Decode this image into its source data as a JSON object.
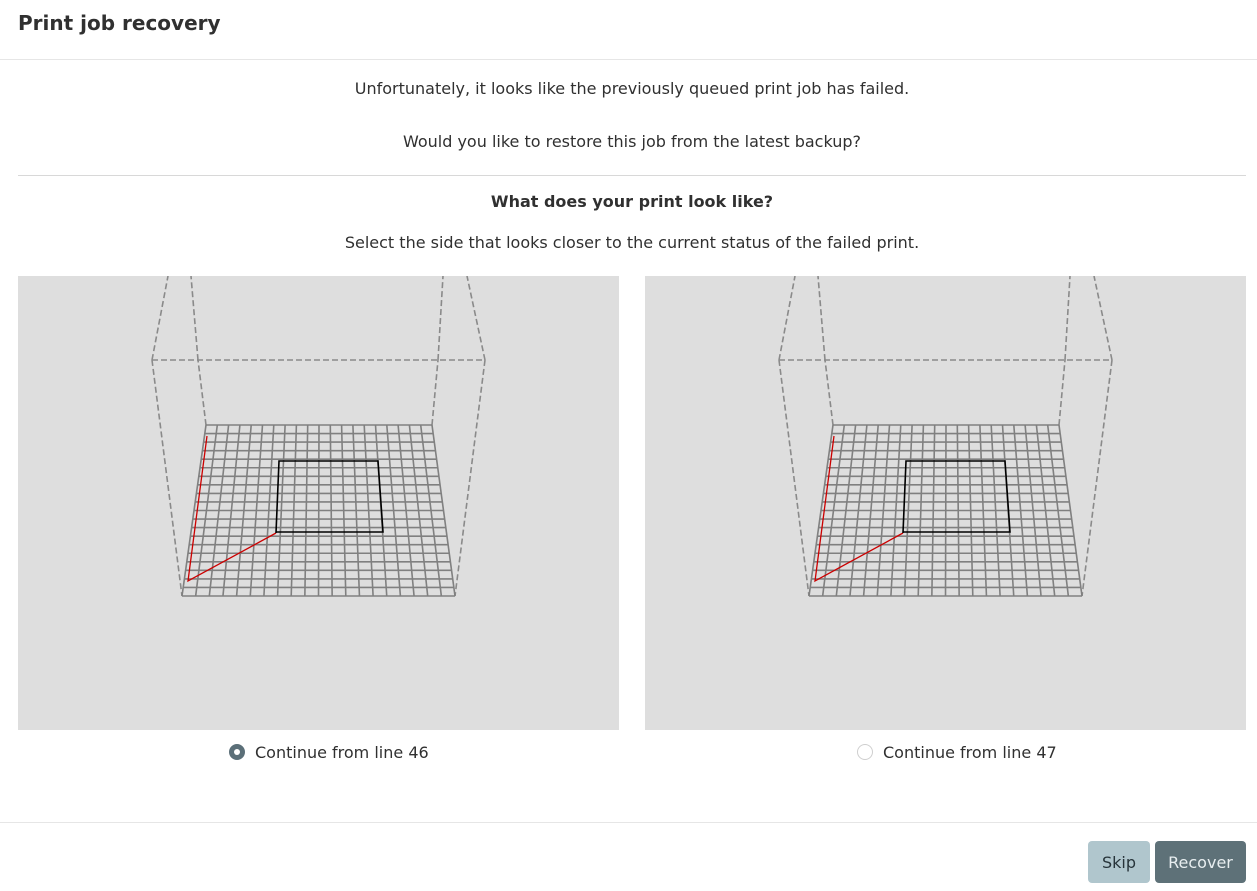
{
  "dialog": {
    "title": "Print job recovery"
  },
  "message": {
    "line1": "Unfortunately, it looks like the previously queued print job has failed.",
    "line2": "Would you like to restore this job from the latest backup?"
  },
  "selection": {
    "question": "What does your print look like?",
    "instruction": "Select the side that looks closer to the current status of the failed print."
  },
  "options": [
    {
      "label": "Continue from line 46",
      "selected": true
    },
    {
      "label": "Continue from line 47",
      "selected": false
    }
  ],
  "buttons": {
    "skip": "Skip",
    "recover": "Recover"
  },
  "colors": {
    "preview_background": "#dedede",
    "toolpath_travel": "#cc0000",
    "toolpath_print": "#000000",
    "bed_grid": "#808080",
    "accent": "#5e7178"
  }
}
